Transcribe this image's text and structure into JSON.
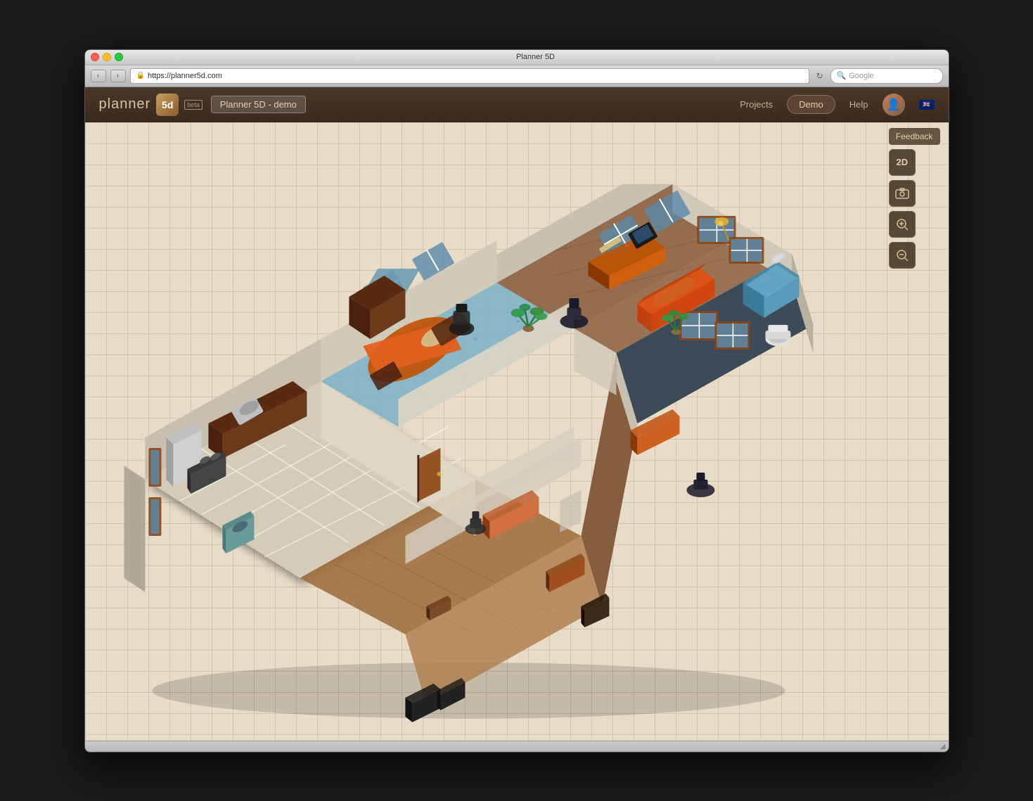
{
  "window": {
    "title": "Planner 5D",
    "traffic_lights": [
      "close",
      "minimize",
      "maximize"
    ]
  },
  "browser": {
    "back_label": "‹",
    "forward_label": "›",
    "url": "https://planner5d.com",
    "url_icon": "🔒",
    "refresh_label": "↻",
    "search_placeholder": "Google"
  },
  "header": {
    "logo_text": "planner",
    "logo_icon": "5d",
    "beta_label": "beta",
    "project_name": "Planner 5D - demo",
    "nav": {
      "projects_label": "Projects",
      "demo_label": "Demo",
      "help_label": "Help"
    }
  },
  "toolbar": {
    "feedback_label": "Feedback",
    "view_2d_label": "2D",
    "camera_icon": "📷",
    "zoom_in_icon": "🔍+",
    "zoom_out_icon": "🔍-"
  }
}
